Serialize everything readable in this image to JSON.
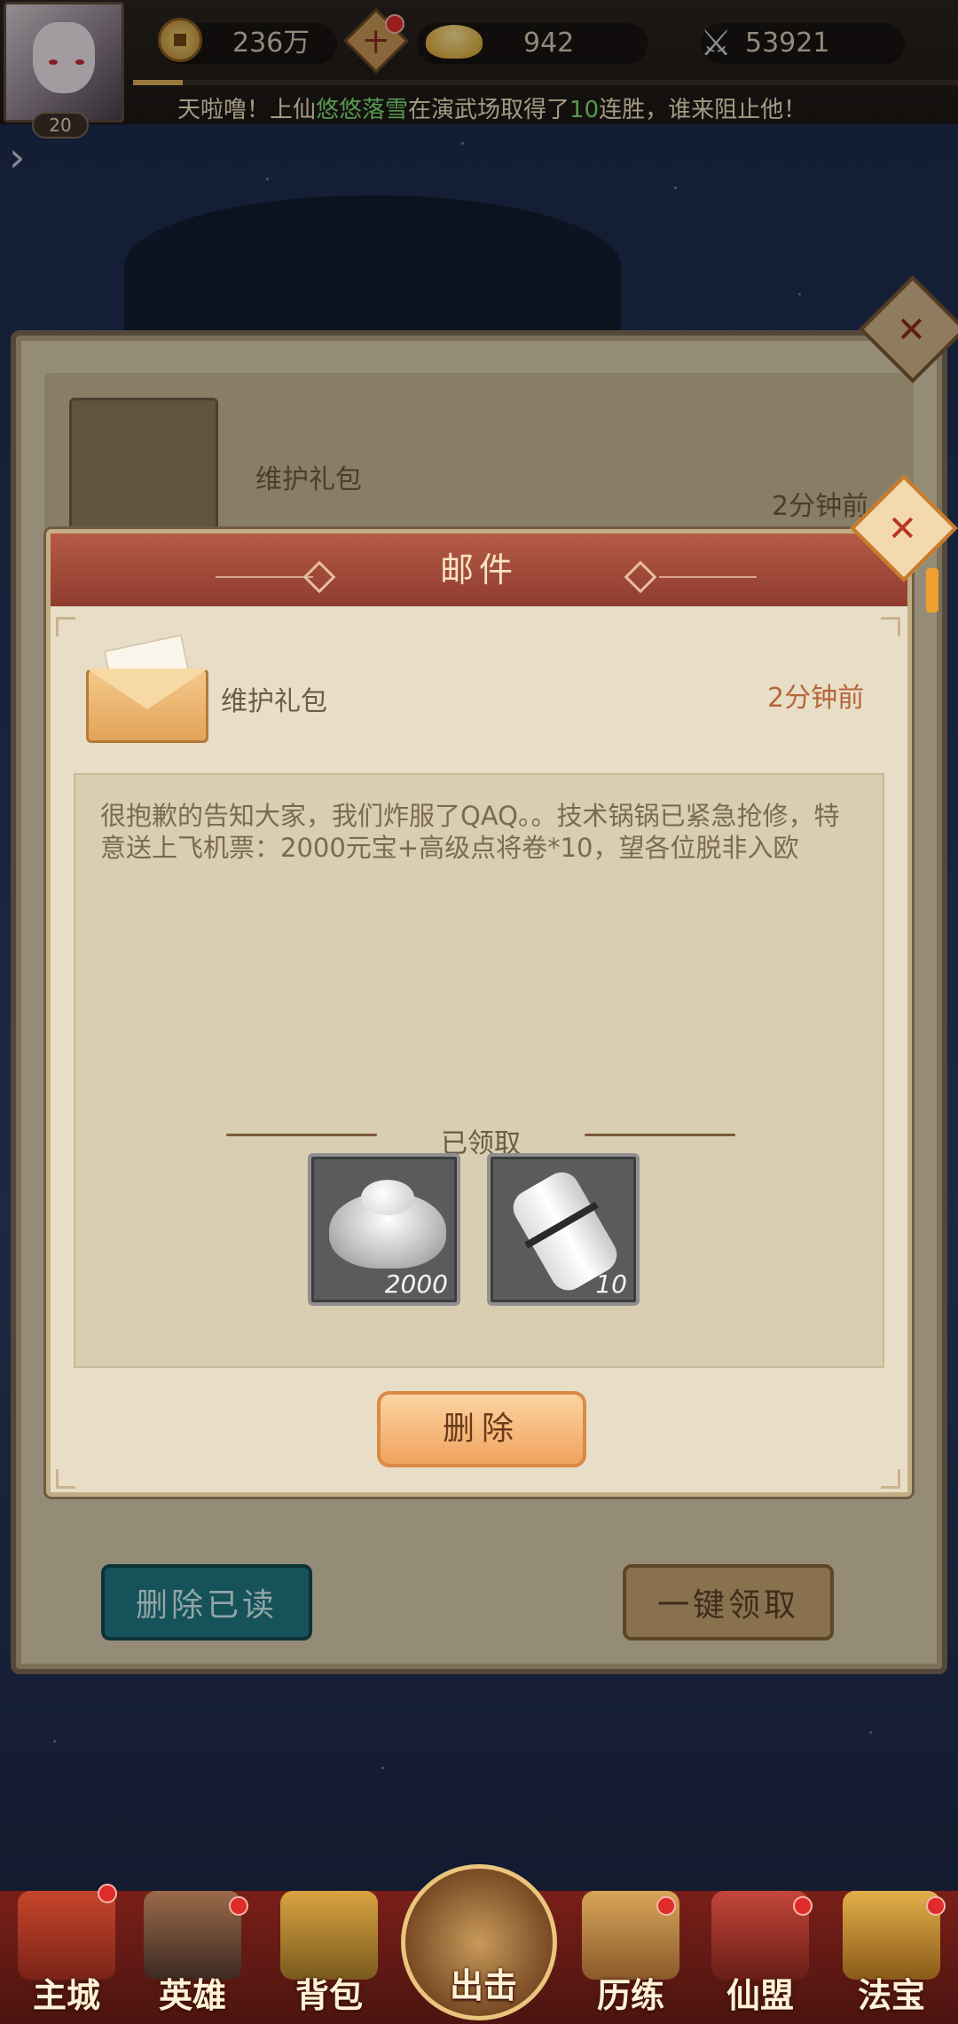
{
  "topbar": {
    "level": "20",
    "copper": "236万",
    "gold": "942",
    "power": "53921",
    "marquee_prefix": "天啦噜！上仙",
    "marquee_name": "悠悠落雪",
    "marquee_middle": "在演武场取得了",
    "marquee_count": "10",
    "marquee_suffix": "连胜，谁来阻止他！",
    "exp_fraction": 0.06
  },
  "mail_list": {
    "item_title": "维护礼包",
    "item_time": "2分钟前",
    "delete_read_label": "删除已读",
    "claim_all_label": "一键领取"
  },
  "dialog": {
    "title": "邮件",
    "mail_title": "维护礼包",
    "mail_time": "2分钟前",
    "body": "很抱歉的告知大家，我们炸服了QAQ。。技术锅锅已紧急抢修，特意送上飞机票：2000元宝+高级点将卷*10，望各位脱非入欧",
    "claimed_label": "已领取",
    "rewards": [
      {
        "icon": "silver-ingot-icon",
        "amount": "2000"
      },
      {
        "icon": "scroll-icon",
        "amount": "10"
      }
    ],
    "delete_label": "删除"
  },
  "bottom_nav": {
    "items": [
      {
        "label": "主城",
        "icon": "main-city-icon"
      },
      {
        "label": "英雄",
        "icon": "hero-icon"
      },
      {
        "label": "背包",
        "icon": "backpack-icon"
      },
      {
        "label": "出击",
        "icon": "attack-icon"
      },
      {
        "label": "历练",
        "icon": "training-icon"
      },
      {
        "label": "仙盟",
        "icon": "alliance-icon"
      },
      {
        "label": "法宝",
        "icon": "treasure-icon"
      }
    ]
  },
  "colors": {
    "header_red": "#8f3c2f",
    "accent_orange": "#f0a35f",
    "teal_button": "#1f7a85",
    "nav_bg": "#6b1b15"
  }
}
